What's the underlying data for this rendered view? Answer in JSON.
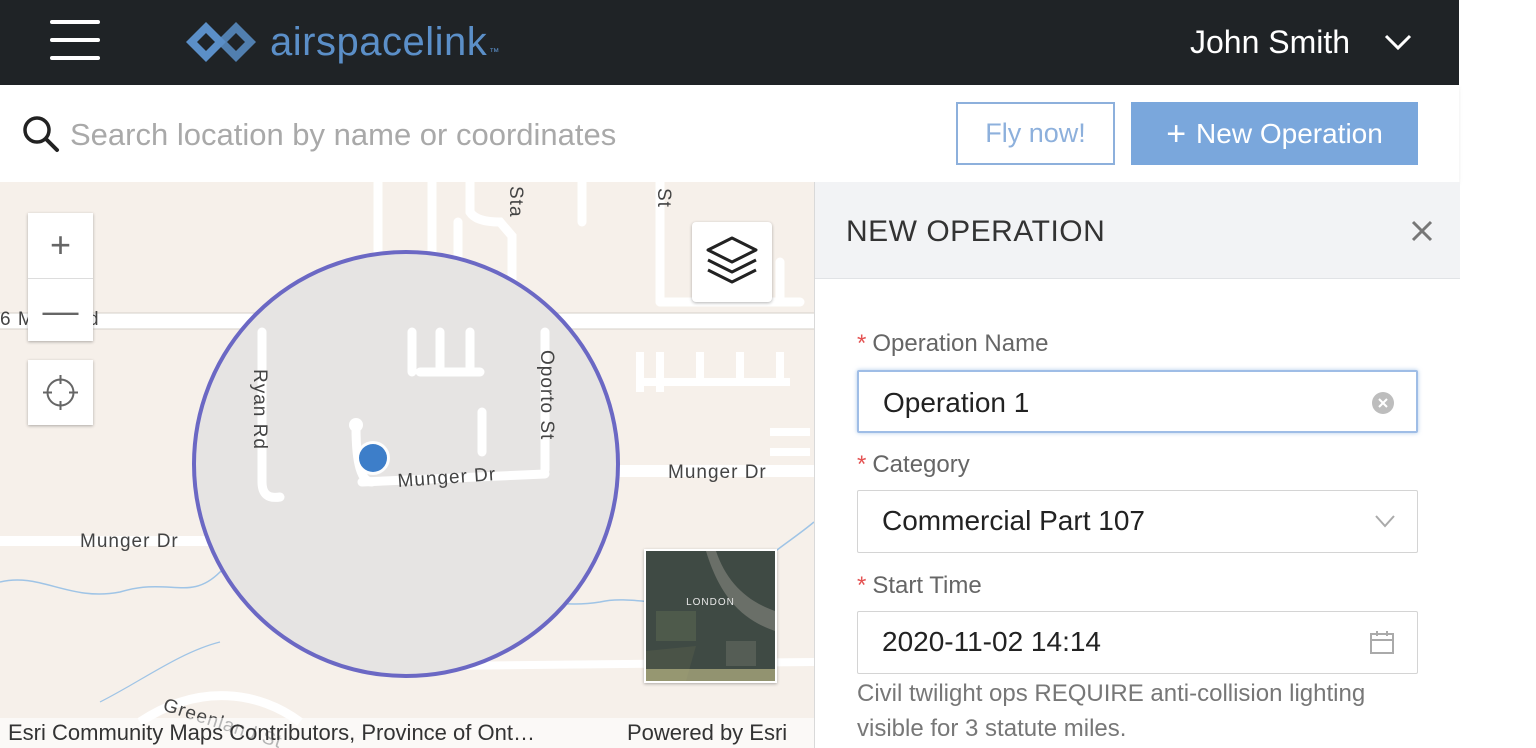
{
  "header": {
    "brand": "airspacelink",
    "trademark": "™",
    "user_name": "John Smith"
  },
  "search": {
    "placeholder": "Search location by name or coordinates",
    "fly_now_label": "Fly now!",
    "new_operation_plus": "+",
    "new_operation_label": "New Operation"
  },
  "map": {
    "zoom_in": "+",
    "zoom_out": "—",
    "streets": {
      "ryan": "Ryan Rd",
      "oporto": "Oporto St",
      "munger_center": "Munger Dr",
      "munger_right": "Munger Dr",
      "munger_left": "Munger Dr",
      "greenland": "Greenland St",
      "six_mile_a": "6 M",
      "six_mile_b": "d",
      "st_top_a": "St",
      "st_top_b": "Sta"
    },
    "basemap_label": "LONDON",
    "attribution_left": "Esri Community Maps Contributors, Province of Ont…",
    "attribution_right": "Powered by Esri"
  },
  "panel": {
    "title": "NEW OPERATION",
    "required_mark": "*",
    "fields": {
      "operation_name": {
        "label": "Operation Name",
        "value": "Operation 1"
      },
      "category": {
        "label": "Category",
        "value": "Commercial Part 107"
      },
      "start_time": {
        "label": "Start Time",
        "value": "2020-11-02 14:14"
      }
    },
    "note": "Civil twilight ops REQUIRE anti-collision lighting visible for 3 statute miles."
  },
  "colors": {
    "topbar": "#1f2326",
    "accent": "#7aa7dc",
    "radius_ring": "#6b68c4",
    "location_dot": "#3d7ec9",
    "required": "#e45252"
  },
  "icons": {
    "menu": "menu-icon",
    "search": "search-icon",
    "user_menu": "chevron-down-icon",
    "layers": "layers-icon",
    "locate": "crosshair-icon",
    "close": "close-icon",
    "clear": "clear-icon",
    "category_dropdown": "chevron-down-icon",
    "calendar": "calendar-icon"
  }
}
